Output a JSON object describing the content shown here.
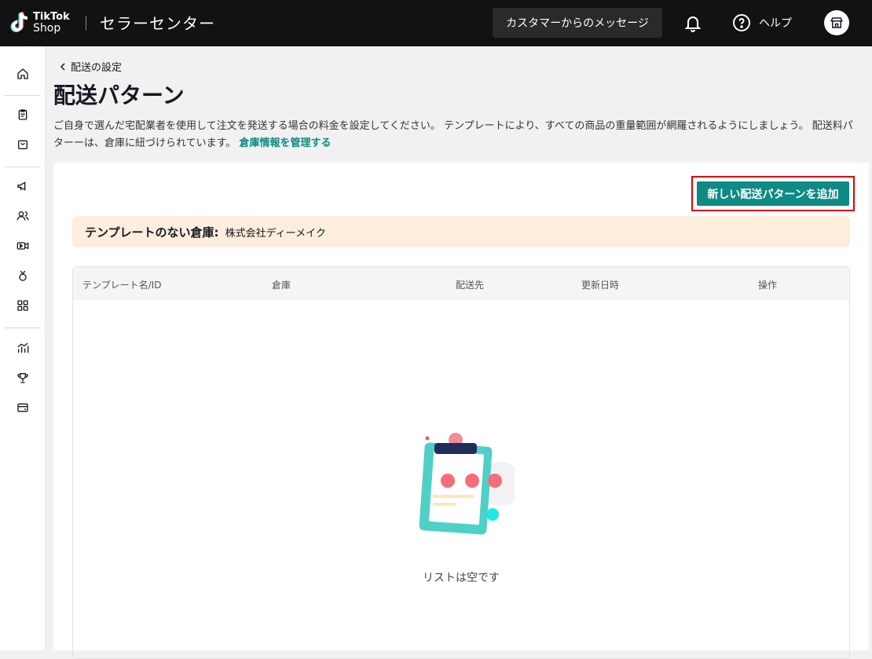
{
  "header": {
    "logo_line1": "TikTok",
    "logo_line2": "Shop",
    "title": "セラーセンター",
    "messages_button": "カスタマーからのメッセージ",
    "help_label": "ヘルプ",
    "icons": [
      "bell-icon",
      "help-circle-icon",
      "store-icon"
    ]
  },
  "sidebar": {
    "icons": [
      "home-icon",
      "clipboard-icon",
      "shopping-bag-icon",
      "megaphone-icon",
      "users-icon",
      "video-icon",
      "medal-icon",
      "apps-icon",
      "analytics-icon",
      "trophy-icon",
      "wallet-icon"
    ]
  },
  "breadcrumb": {
    "back_label": "配送の設定"
  },
  "page": {
    "title": "配送パターン",
    "description": "ご自身で選んだ宅配業者を使用して注文を発送する場合の料金を設定してください。 テンプレートにより、すべての商品の重量範囲が網羅されるようにしましょう。 配送料パターーは、倉庫に紐づけられています。",
    "manage_link": "倉庫情報を管理する"
  },
  "actions": {
    "add_template": "新しい配送パターンを追加"
  },
  "banner": {
    "label": "テンプレートのない倉庫:",
    "value": "株式会社ディーメイク"
  },
  "table": {
    "columns": [
      "テンプレート名/ID",
      "倉庫",
      "配送先",
      "更新日時",
      "操作"
    ],
    "rows": [],
    "empty_text": "リストは空です"
  },
  "colors": {
    "accent": "#0f8a85",
    "link": "#0e8a82",
    "banner_bg": "#fbeedc",
    "highlight_frame": "#e20000"
  }
}
